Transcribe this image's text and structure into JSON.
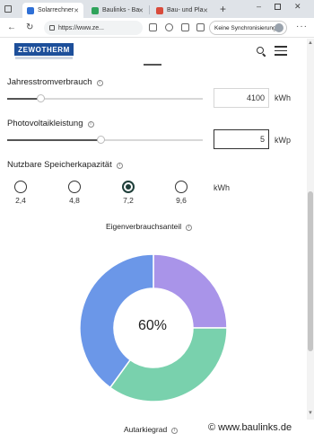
{
  "browser": {
    "tabs": [
      {
        "label": "Solarrechner",
        "active": true,
        "color": "#2e6fd6"
      },
      {
        "label": "Baulinks - Ba",
        "active": false,
        "color": "#2fa35b"
      },
      {
        "label": "Bau- und Pla",
        "active": false,
        "color": "#d94b3b"
      }
    ],
    "new_tab": "+",
    "url": "https://www.ze...",
    "sync_label": "Keine Synchronisierung",
    "menu": "···"
  },
  "site": {
    "logo": "ZEWOTHERM"
  },
  "calculator": {
    "annual_consumption": {
      "label": "Jahresstromverbrauch",
      "value": "4100",
      "unit": "kWh",
      "slider_fraction": 0.17
    },
    "pv_power": {
      "label": "Photovoltaikleistung",
      "value": "5",
      "unit": "kWp",
      "slider_fraction": 0.48
    },
    "storage": {
      "label": "Nutzbare Speicherkapazität",
      "unit": "kWh",
      "options": [
        "2,4",
        "4,8",
        "7,2",
        "9,6"
      ],
      "selected_index": 2
    }
  },
  "chart_data": {
    "type": "pie",
    "title": "Eigenverbrauchsanteil",
    "center_label": "60%",
    "slices": [
      {
        "value": 25,
        "color": "#a994e9"
      },
      {
        "value": 35,
        "color": "#79d1ad"
      },
      {
        "value": 40,
        "color": "#6b97e8"
      }
    ],
    "next_title": "Autarkiegrad"
  },
  "watermark": "© www.baulinks.de"
}
